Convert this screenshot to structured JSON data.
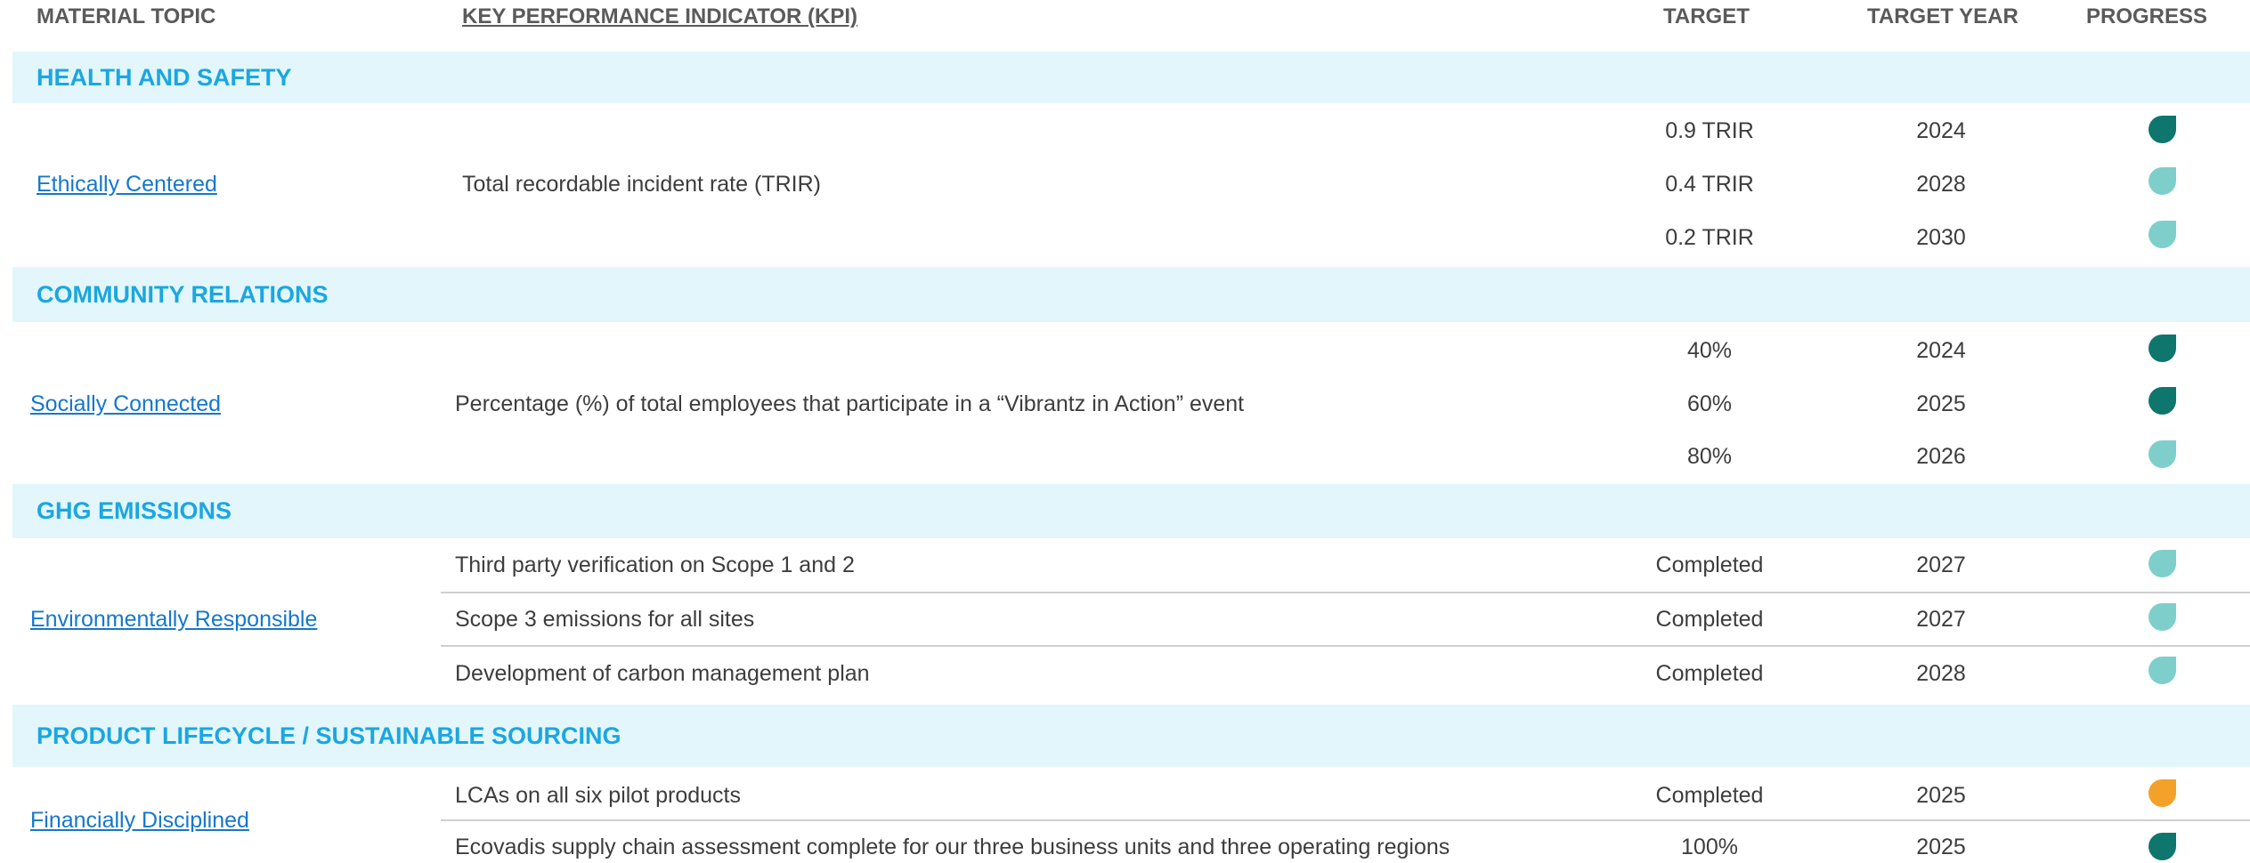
{
  "columns": {
    "material_topic": "MATERIAL TOPIC",
    "kpi": "KEY PERFORMANCE INDICATOR (KPI)",
    "target": "TARGET",
    "target_year": "TARGET YEAR",
    "progress": "PROGRESS"
  },
  "colors": {
    "status_dark_teal": "#0f766e",
    "status_light_teal": "#7ecfcb",
    "status_orange": "#f4a12a",
    "section_band": "#e3f6fc",
    "section_title": "#1aa7e0",
    "link": "#1677cc"
  },
  "sections": [
    {
      "title": "HEALTH AND SAFETY",
      "topic": "Ethically Centered",
      "kpis": [
        {
          "text": "Total recordable incident rate (TRIR)",
          "rows": [
            {
              "target": "0.9 TRIR",
              "year": "2024",
              "progress": "dark"
            },
            {
              "target": "0.4 TRIR",
              "year": "2028",
              "progress": "light"
            },
            {
              "target": "0.2 TRIR",
              "year": "2030",
              "progress": "light"
            }
          ]
        }
      ]
    },
    {
      "title": "COMMUNITY RELATIONS",
      "topic": "Socially Connected",
      "kpis": [
        {
          "text": "Percentage (%) of total employees that participate in a “Vibrantz in Action” event",
          "rows": [
            {
              "target": "40%",
              "year": "2024",
              "progress": "dark"
            },
            {
              "target": "60%",
              "year": "2025",
              "progress": "dark"
            },
            {
              "target": "80%",
              "year": "2026",
              "progress": "light"
            }
          ]
        }
      ]
    },
    {
      "title": "GHG EMISSIONS",
      "topic": "Environmentally Responsible",
      "kpis": [
        {
          "text": "Third party verification on Scope 1 and 2",
          "rows": [
            {
              "target": "Completed",
              "year": "2027",
              "progress": "light"
            }
          ]
        },
        {
          "text": "Scope 3 emissions for all sites",
          "rows": [
            {
              "target": "Completed",
              "year": "2027",
              "progress": "light"
            }
          ]
        },
        {
          "text": "Development of carbon management plan",
          "rows": [
            {
              "target": "Completed",
              "year": "2028",
              "progress": "light"
            }
          ]
        }
      ]
    },
    {
      "title": "PRODUCT LIFECYCLE / SUSTAINABLE SOURCING",
      "topic": "Financially Disciplined",
      "kpis": [
        {
          "text": "LCAs on all six pilot products",
          "rows": [
            {
              "target": "Completed",
              "year": "2025",
              "progress": "orange"
            }
          ]
        },
        {
          "text": "Ecovadis supply chain assessment complete for our three business units and three operating regions",
          "rows": [
            {
              "target": "100%",
              "year": "2025",
              "progress": "dark"
            }
          ]
        }
      ]
    }
  ]
}
